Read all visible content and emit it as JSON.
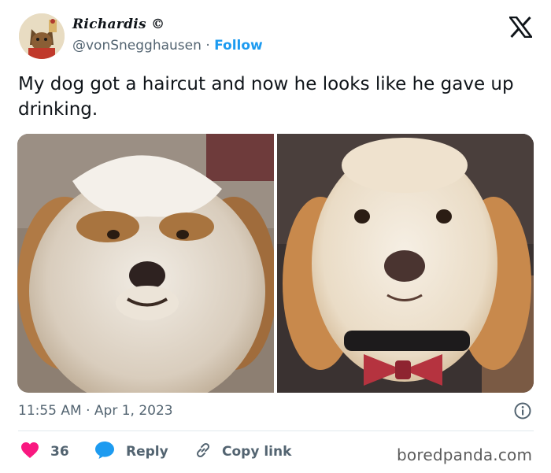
{
  "author": {
    "display_name": "Richardis ©",
    "handle": "@vonSnegghausen",
    "separator": "·",
    "follow_label": "Follow"
  },
  "platform_icon": "x-logo-icon",
  "tweet": {
    "text": "My dog got a haircut and now he looks like he gave up drinking."
  },
  "media": [
    {
      "name": "dog-before-haircut-photo"
    },
    {
      "name": "dog-after-haircut-photo"
    }
  ],
  "meta": {
    "time": "11:55 AM",
    "separator": "·",
    "date": "Apr 1, 2023",
    "info_icon": "info-icon"
  },
  "actions": {
    "likes_count": "36",
    "reply_label": "Reply",
    "copy_link_label": "Copy link"
  },
  "colors": {
    "accent": "#1d9bf0",
    "like": "#f91880",
    "text_primary": "#0f1419",
    "text_secondary": "#536471"
  },
  "watermark": "boredpanda.com"
}
